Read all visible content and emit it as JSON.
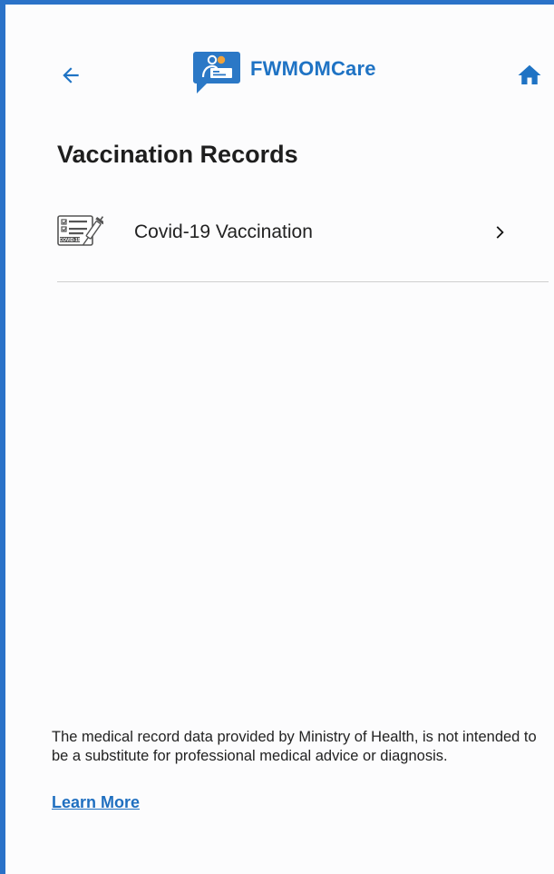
{
  "header": {
    "app_name": "FWMOMCare",
    "back_icon": "arrow-left-icon",
    "home_icon": "home-icon",
    "logo_icon": "fwmomcare-logo-icon",
    "accent_color": "#1f73c4"
  },
  "page": {
    "title": "Vaccination Records"
  },
  "records": [
    {
      "label": "Covid-19 Vaccination",
      "icon": "covid-certificate-icon",
      "icon_caption": "COVID-19",
      "chevron_icon": "chevron-right-icon"
    }
  ],
  "footer": {
    "disclaimer": "The medical record data provided by Ministry of Health, is not intended to be a substitute for professional medical advice or diagnosis.",
    "learn_more_label": "Learn More"
  },
  "colors": {
    "frame_border": "#2a72c8",
    "link": "#1f6fc0"
  }
}
